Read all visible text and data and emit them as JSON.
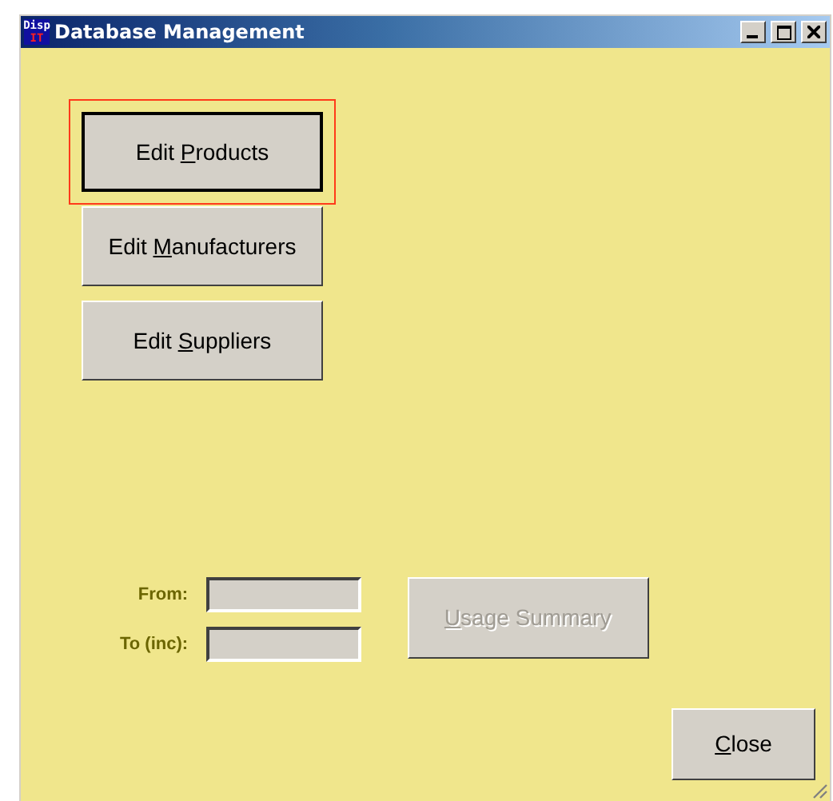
{
  "window": {
    "title": "Database Management",
    "app_icon": {
      "top": "Disp",
      "bottom": "IT"
    }
  },
  "buttons": [
    {
      "before": "Edit ",
      "key": "P",
      "after": "roducts",
      "focused": true,
      "disabled": false
    },
    {
      "before": "Edit ",
      "key": "M",
      "after": "anufacturers",
      "focused": false,
      "disabled": false
    },
    {
      "before": "Edit ",
      "key": "S",
      "after": "uppliers",
      "focused": false,
      "disabled": false
    }
  ],
  "date_fields": [
    {
      "label": "From:"
    },
    {
      "label": "To (inc):"
    }
  ],
  "usage_button": {
    "key": "U",
    "after": "sage Summary",
    "focused": false,
    "disabled": true
  },
  "close_button": {
    "key": "C",
    "after": "lose",
    "focused": false,
    "disabled": false
  }
}
